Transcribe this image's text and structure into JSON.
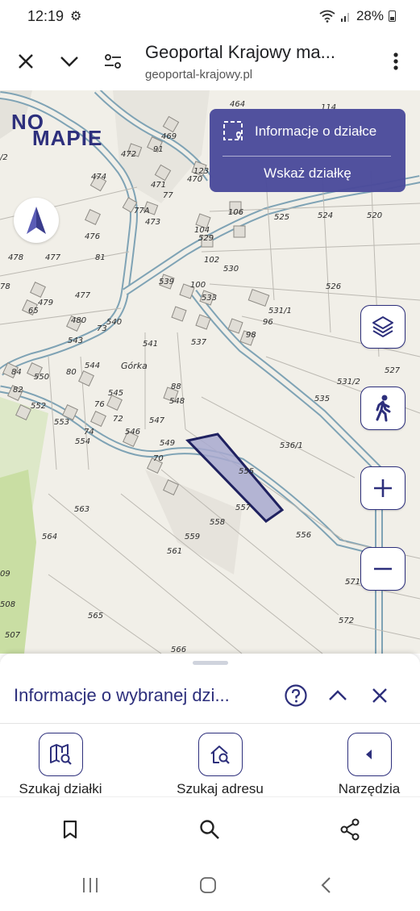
{
  "status": {
    "time": "12:19",
    "battery": "28%"
  },
  "browser": {
    "title": "Geoportal Krajowy ma...",
    "url": "geoportal-krajowy.pl"
  },
  "logo": {
    "line1": "NO",
    "line2": "MAPIE"
  },
  "info_panel": {
    "primary": "Informacje o działce",
    "secondary": "Wskaż działkę"
  },
  "map_labels": [
    {
      "t": "464"
    },
    {
      "t": "469"
    },
    {
      "t": "91"
    },
    {
      "t": "472"
    },
    {
      "t": "474"
    },
    {
      "t": "471"
    },
    {
      "t": "77"
    },
    {
      "t": "470"
    },
    {
      "t": "123"
    },
    {
      "t": "476"
    },
    {
      "t": "77A"
    },
    {
      "t": "473"
    },
    {
      "t": "81"
    },
    {
      "t": "478"
    },
    {
      "t": "477"
    },
    {
      "t": "479"
    },
    {
      "t": "65"
    },
    {
      "t": "477"
    },
    {
      "t": "104"
    },
    {
      "t": "529"
    },
    {
      "t": "102"
    },
    {
      "t": "530"
    },
    {
      "t": "106"
    },
    {
      "t": "525"
    },
    {
      "t": "524"
    },
    {
      "t": "520"
    },
    {
      "t": "526"
    },
    {
      "t": "539"
    },
    {
      "t": "100"
    },
    {
      "t": "533"
    },
    {
      "t": "531/1"
    },
    {
      "t": "96"
    },
    {
      "t": "98"
    },
    {
      "t": "480"
    },
    {
      "t": "73"
    },
    {
      "t": "540"
    },
    {
      "t": "543"
    },
    {
      "t": "541"
    },
    {
      "t": "537"
    },
    {
      "t": "527"
    },
    {
      "t": "84"
    },
    {
      "t": "550"
    },
    {
      "t": "80"
    },
    {
      "t": "544"
    },
    {
      "t": "Górka"
    },
    {
      "t": "531/2"
    },
    {
      "t": "82"
    },
    {
      "t": "545"
    },
    {
      "t": "88"
    },
    {
      "t": "548"
    },
    {
      "t": "535"
    },
    {
      "t": "552"
    },
    {
      "t": "76"
    },
    {
      "t": "72"
    },
    {
      "t": "553"
    },
    {
      "t": "547"
    },
    {
      "t": "74"
    },
    {
      "t": "554"
    },
    {
      "t": "546"
    },
    {
      "t": "549"
    },
    {
      "t": "536/1"
    },
    {
      "t": "70"
    },
    {
      "t": "555"
    },
    {
      "t": "563"
    },
    {
      "t": "557"
    },
    {
      "t": "558"
    },
    {
      "t": "564"
    },
    {
      "t": "559"
    },
    {
      "t": "556"
    },
    {
      "t": "561"
    },
    {
      "t": "09"
    },
    {
      "t": "571"
    },
    {
      "t": "508"
    },
    {
      "t": "565"
    },
    {
      "t": "572"
    },
    {
      "t": "507"
    },
    {
      "t": "566"
    },
    {
      "t": "/2"
    },
    {
      "t": "78"
    },
    {
      "t": "114"
    }
  ],
  "sheet": {
    "title": "Informacje o wybranej dzi..."
  },
  "tools": [
    {
      "label": "Szukaj działki",
      "icon": "map-search-icon"
    },
    {
      "label": "Szukaj adresu",
      "icon": "home-search-icon"
    },
    {
      "label": "Narzędzia",
      "icon": "chevron-left-icon"
    }
  ]
}
